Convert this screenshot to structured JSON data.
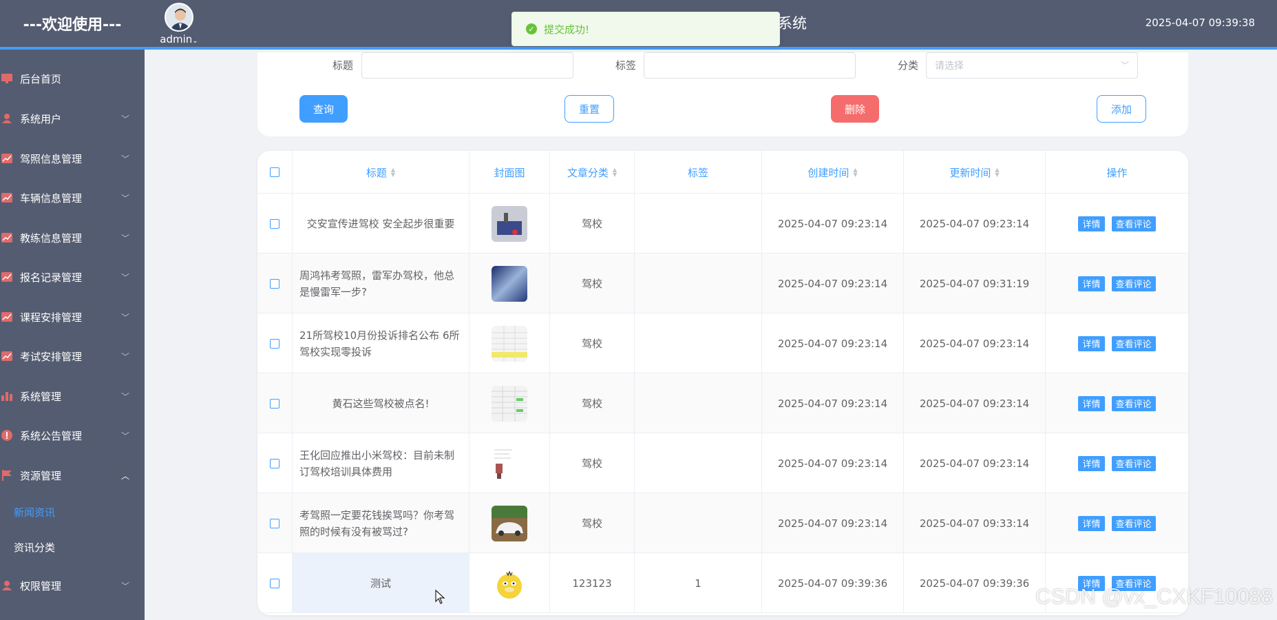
{
  "header": {
    "brand": "---欢迎使用---",
    "user": "admin",
    "title_visible": "系统",
    "clock": "2025-04-07 09:39:38"
  },
  "toast": {
    "message": "提交成功!"
  },
  "sidebar": {
    "items": [
      {
        "label": "后台首页",
        "icon": "monitor-icon"
      },
      {
        "label": "系统用户",
        "icon": "user-icon"
      },
      {
        "label": "驾照信息管理",
        "icon": "chart-icon"
      },
      {
        "label": "车辆信息管理",
        "icon": "chart-icon"
      },
      {
        "label": "教练信息管理",
        "icon": "chart-icon"
      },
      {
        "label": "报名记录管理",
        "icon": "chart-icon"
      },
      {
        "label": "课程安排管理",
        "icon": "chart-icon"
      },
      {
        "label": "考试安排管理",
        "icon": "chart-icon"
      },
      {
        "label": "系统管理",
        "icon": "bar-icon"
      },
      {
        "label": "系统公告管理",
        "icon": "info-icon"
      },
      {
        "label": "资源管理",
        "icon": "flag-icon"
      },
      {
        "label": "权限管理",
        "icon": "user-icon"
      }
    ],
    "sub_items": [
      {
        "label": "新闻资讯",
        "active": true
      },
      {
        "label": "资讯分类",
        "active": false
      }
    ]
  },
  "search": {
    "title_label": "标题",
    "tag_label": "标签",
    "category_label": "分类",
    "category_placeholder": "请选择",
    "query_btn": "查询",
    "reset_btn": "重置",
    "delete_btn": "删除",
    "add_btn": "添加"
  },
  "table": {
    "headers": {
      "title": "标题",
      "cover": "封面图",
      "category": "文章分类",
      "tag": "标签",
      "created": "创建时间",
      "updated": "更新时间",
      "action": "操作"
    },
    "rows": [
      {
        "title": "交安宣传进驾校 安全起步很重要",
        "category": "驾校",
        "tag": "",
        "created": "2025-04-07 09:23:14",
        "updated": "2025-04-07 09:23:14"
      },
      {
        "title": "周鸿祎考驾照，雷军办驾校，他总是慢雷军一步?",
        "category": "驾校",
        "tag": "",
        "created": "2025-04-07 09:23:14",
        "updated": "2025-04-07 09:31:19"
      },
      {
        "title": "21所驾校10月份投诉排名公布 6所驾校实现零投诉",
        "category": "驾校",
        "tag": "",
        "created": "2025-04-07 09:23:14",
        "updated": "2025-04-07 09:23:14"
      },
      {
        "title": "黄石这些驾校被点名!",
        "category": "驾校",
        "tag": "",
        "created": "2025-04-07 09:23:14",
        "updated": "2025-04-07 09:23:14"
      },
      {
        "title": "王化回应推出小米驾校：目前未制订驾校培训具体费用",
        "category": "驾校",
        "tag": "",
        "created": "2025-04-07 09:23:14",
        "updated": "2025-04-07 09:23:14"
      },
      {
        "title": "考驾照一定要花钱挨骂吗？你考驾照的时候有没有被骂过?",
        "category": "驾校",
        "tag": "",
        "created": "2025-04-07 09:23:14",
        "updated": "2025-04-07 09:33:14"
      },
      {
        "title": "测试",
        "category": "123123",
        "tag": "1",
        "created": "2025-04-07 09:39:36",
        "updated": "2025-04-07 09:39:36"
      }
    ],
    "detail_btn": "详情",
    "comment_btn": "查看评论"
  },
  "watermark": "CSDN @vx_CXKF10088"
}
